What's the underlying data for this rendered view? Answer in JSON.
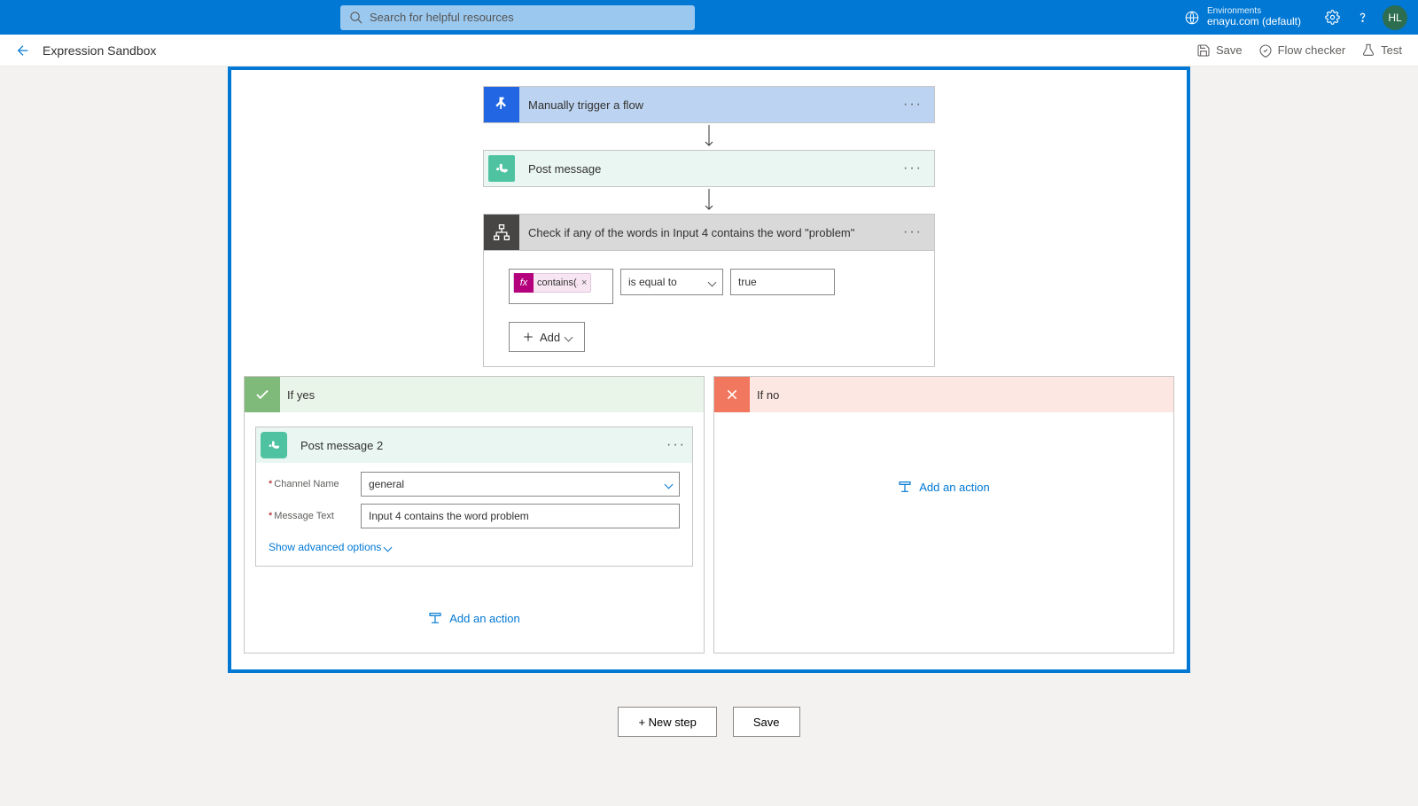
{
  "topbar": {
    "search_placeholder": "Search for helpful resources",
    "env_label": "Environments",
    "env_value": "enayu.com (default)",
    "avatar": "HL"
  },
  "subheader": {
    "title": "Expression Sandbox",
    "save": "Save",
    "flow_checker": "Flow checker",
    "test": "Test"
  },
  "flow": {
    "trigger_label": "Manually trigger a flow",
    "post_message_label": "Post message",
    "condition_label": "Check if any of the words in Input 4 contains the word \"problem\"",
    "condition": {
      "expression_pill": "contains(...",
      "operator": "is equal to",
      "value": "true",
      "add_label": "Add"
    },
    "branch_yes": {
      "label": "If yes",
      "action_title": "Post message 2",
      "channel_label": "Channel Name",
      "channel_value": "general",
      "message_label": "Message Text",
      "message_value": "Input 4 contains the word problem",
      "advanced": "Show advanced options",
      "add_action": "Add an action"
    },
    "branch_no": {
      "label": "If no",
      "add_action": "Add an action"
    }
  },
  "bottom": {
    "new_step": "+ New step",
    "save": "Save"
  }
}
